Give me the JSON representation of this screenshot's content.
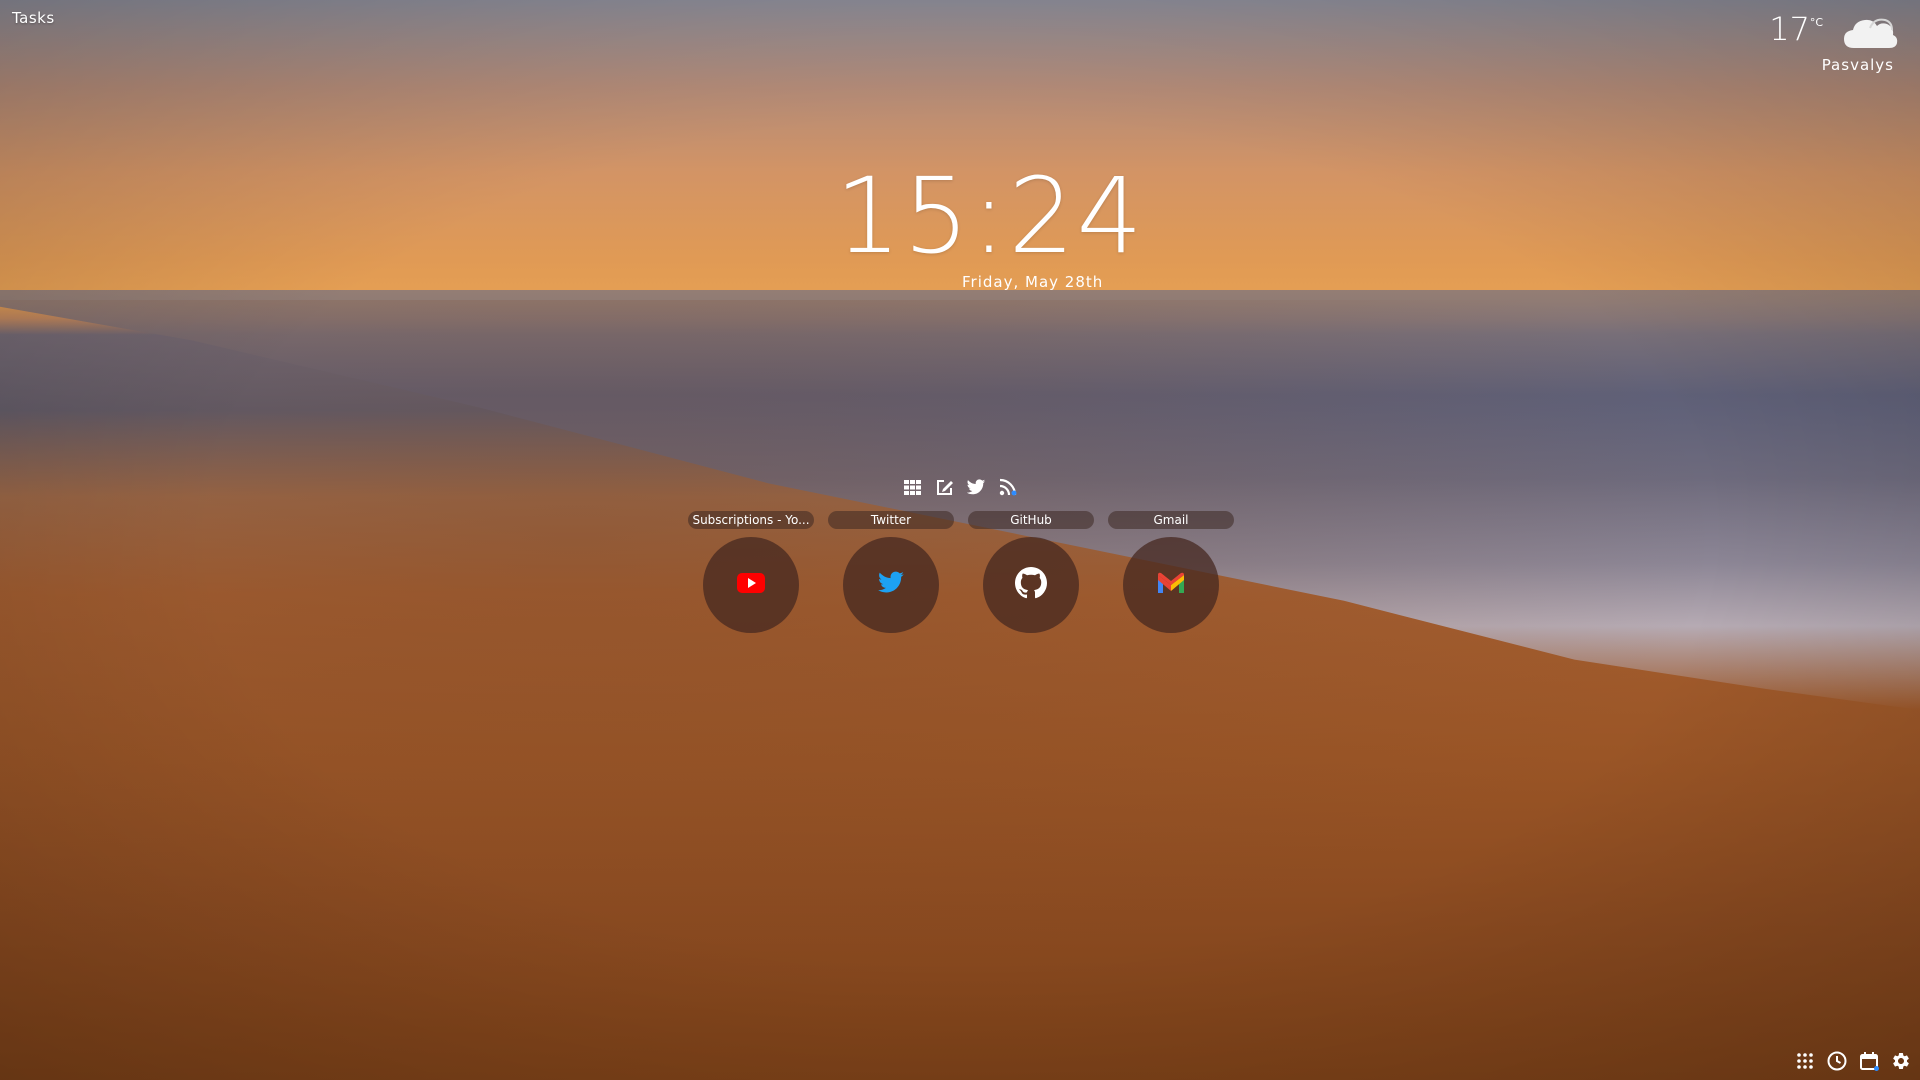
{
  "top_left": {
    "tasks_label": "Tasks"
  },
  "weather": {
    "temperature": "17",
    "unit": "°C",
    "condition_icon": "cloud-icon",
    "location": "Pasvalys"
  },
  "clock": {
    "time": "15:24",
    "date": "Friday, May 28th"
  },
  "quick_bar": {
    "items": [
      {
        "icon": "apps-grid-icon"
      },
      {
        "icon": "edit-note-icon"
      },
      {
        "icon": "twitter-icon"
      },
      {
        "icon": "rss-feed-icon"
      }
    ]
  },
  "shortcuts": [
    {
      "label": "Subscriptions - Yo...",
      "icon": "youtube-icon",
      "color": "#ff0000"
    },
    {
      "label": "Twitter",
      "icon": "twitter-icon",
      "color": "#1da1f2"
    },
    {
      "label": "GitHub",
      "icon": "github-icon",
      "color": "#ffffff"
    },
    {
      "label": "Gmail",
      "icon": "gmail-icon",
      "color": "#ea4335"
    }
  ],
  "corner_tools": [
    {
      "icon": "apps-grid-icon"
    },
    {
      "icon": "clock-icon"
    },
    {
      "icon": "calendar-icon"
    },
    {
      "icon": "settings-gear-icon"
    }
  ]
}
